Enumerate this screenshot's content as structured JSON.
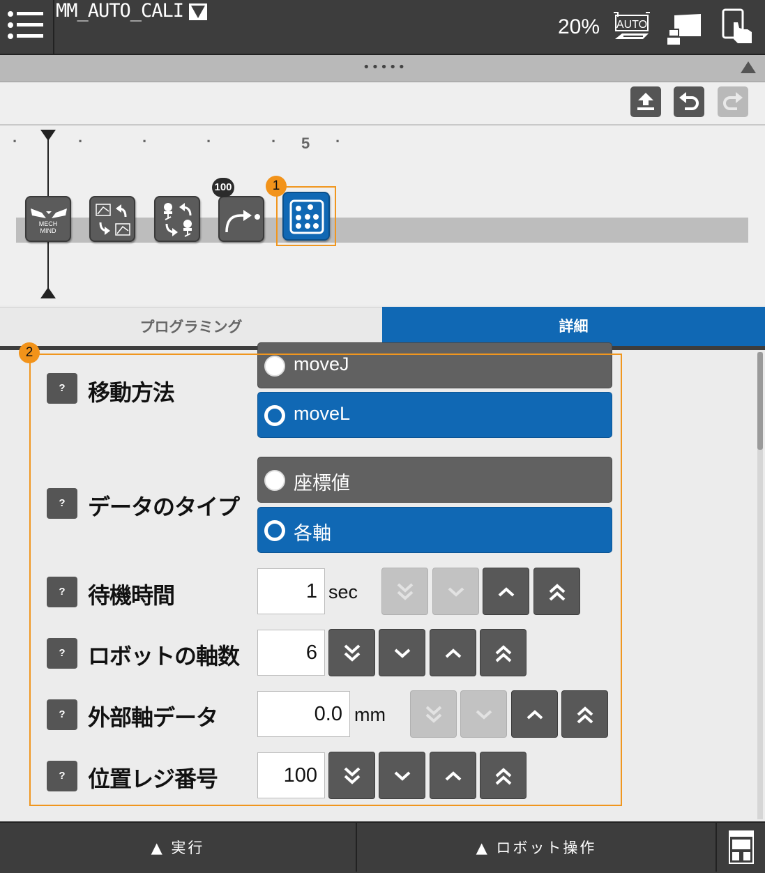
{
  "header": {
    "program_name": "MM_AUTO_CALI",
    "speed": "20%",
    "icons": [
      "menu-icon",
      "dropdown-triangle-icon",
      "auto-mode-icon",
      "pendant-display-icon",
      "touch-icon"
    ]
  },
  "toolbar": {
    "icons": [
      "upload-icon",
      "undo-icon",
      "redo-icon"
    ]
  },
  "timeline": {
    "ruler_label": "5",
    "nodes": [
      {
        "name": "mech-mind",
        "label_top": "MECH",
        "label_bottom": "MIND"
      },
      {
        "name": "coordinate-switch"
      },
      {
        "name": "robot-switch"
      },
      {
        "name": "move",
        "badge": "100"
      },
      {
        "name": "detail-grid",
        "selected": true
      }
    ],
    "callout_1": "1"
  },
  "tabs": {
    "programming": "プログラミング",
    "detail": "詳細",
    "active": "detail"
  },
  "detail": {
    "callout_2": "2",
    "help_label": "?",
    "move_method": {
      "label": "移動方法",
      "options": [
        "moveJ",
        "moveL"
      ],
      "selected": "moveL"
    },
    "data_type": {
      "label": "データのタイプ",
      "options": [
        "座標値",
        "各軸"
      ],
      "selected": "各軸"
    },
    "wait_time": {
      "label": "待機時間",
      "value": "1",
      "unit": "sec",
      "down_enabled": false,
      "up_enabled": true
    },
    "axis_count": {
      "label": "ロボットの軸数",
      "value": "6",
      "down_enabled": true,
      "up_enabled": true
    },
    "external_axis": {
      "label": "外部軸データ",
      "value": "0.0",
      "unit": "mm",
      "down_enabled": false,
      "up_enabled": true
    },
    "position_register": {
      "label": "位置レジ番号",
      "value": "100",
      "down_enabled": true,
      "up_enabled": true
    }
  },
  "bottom": {
    "run": "▲ 実行",
    "robot_op": "▲ ロボット操作"
  },
  "colors": {
    "accent_blue": "#1068b4",
    "header_dark": "#3d3d3d",
    "highlight_orange": "#f0961e"
  }
}
